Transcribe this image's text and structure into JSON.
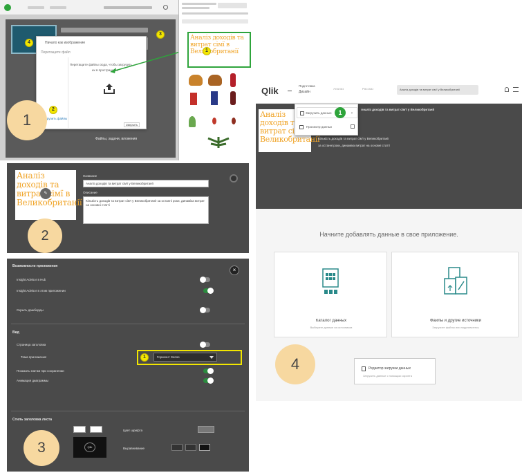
{
  "panel1": {
    "step": "1",
    "dialog_title": "Начало как изображение",
    "dialog_sub": "Перетащите файл",
    "drop_text_1": "Перетащите файлы сюда, чтобы загрузить",
    "drop_text_2": "их в пространство",
    "footer_link": "Загрузить файлы",
    "cancel_label": "Закрыть",
    "note_text": "Аналіз доходів та витрат сімї в Великобританії",
    "badges": [
      "4",
      "2",
      "3"
    ],
    "bottom_text": "Файлы, задачи, вложения"
  },
  "panel2": {
    "step": "2",
    "image_text": "Аналіз доходів та витрат сімї в Великобританії",
    "name_label": "Название",
    "name_value": "Аналіз доходів та витрат сім'ї у Великобританії",
    "desc_label": "Описание",
    "desc_value": "Кількість доходів та витрат сім'ї у Великобританії за останні роки, динаміка витрат на основні статті"
  },
  "panel3": {
    "step": "3",
    "section1_title": "Возможности приложения",
    "opt1": "Insight Advisor в Hub",
    "opt2": "Insight Advisor в этом приложении",
    "opt3": "Скрыть дашборды",
    "section2_title": "Вид",
    "opt4": "Страница заголовка",
    "opt5": "Тема приложения",
    "theme_badge": "1",
    "theme_value": "Горизонт Sense",
    "opt6": "Показать значки при сохранении",
    "opt7": "Анимация диаграммы",
    "section3_title": "Стиль заголовка листа",
    "font_label": "Цвет шрифта",
    "align_label": "Выравнивание",
    "logo_text": "Qlik"
  },
  "panel4": {
    "step": "4",
    "logo": "Qlik",
    "nav1": "Подготовка",
    "nav1_value": "Дизайн",
    "nav2": "Анализ",
    "nav3": "Рассказ",
    "app_title": "Аналіз доходів та витрат сім'ї у Великобританії",
    "menu_item1": "Загрузить данные",
    "menu_item1_badge": "1",
    "menu_item2": "Просмотр данных",
    "card_title": "Аналіз доходів та витрат сім'ї у Великобританії",
    "desc_line1": "Кількість доходів та витрат сім'ї у Великобританії",
    "desc_line2": "за останні роки, динаміка витрат на основні статті",
    "image_text": "Аналіз доходів та витрат сім'ї Великобританії",
    "start_heading": "Начните добавлять данные в свое приложение.",
    "card1_title": "Каталог данных",
    "card1_sub": "Выберите данные из источников",
    "card2_title": "Файлы и другие источники",
    "card2_sub": "Загрузите файлы или подключитесь",
    "editor_title": "Редактор загрузки данных",
    "editor_sub": "Загрузить данные с помощью скрипта"
  },
  "colors": {
    "dark": "#4b4b4b",
    "qlik_green": "#2ea43b",
    "badge_yellow": "#f2e600",
    "note_orange": "#f0a52a",
    "step_peach": "#f7d8a0"
  }
}
